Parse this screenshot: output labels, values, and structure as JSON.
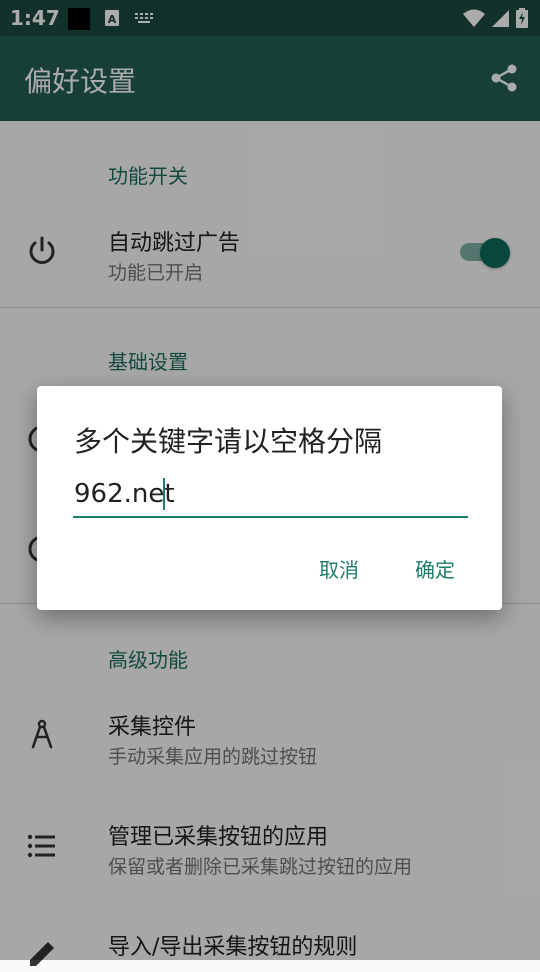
{
  "status_bar": {
    "time": "1:47",
    "icons": [
      "notification-black-square-icon",
      "a-notification-icon",
      "keyboard-icon",
      "wifi-icon",
      "signal-icon",
      "battery-charging-icon"
    ]
  },
  "app_bar": {
    "title": "偏好设置",
    "share_icon": "share-icon"
  },
  "sections": {
    "feature": {
      "header": "功能开关",
      "auto_skip": {
        "title": "自动跳过广告",
        "subtitle": "功能已开启",
        "icon": "power-icon",
        "toggle_on": true
      }
    },
    "basic": {
      "header": "基础设置"
    },
    "advanced": {
      "header": "高级功能",
      "items": [
        {
          "title": "采集控件",
          "subtitle": "手动采集应用的跳过按钮",
          "icon": "compass-icon"
        },
        {
          "title": "管理已采集按钮的应用",
          "subtitle": "保留或者删除已采集跳过按钮的应用",
          "icon": "list-icon"
        },
        {
          "title": "导入/导出采集按钮的规则",
          "icon": "edit-icon"
        }
      ]
    }
  },
  "dialog": {
    "title": "多个关键字请以空格分隔",
    "input_value": "962.net",
    "cancel_label": "取消",
    "ok_label": "确定"
  },
  "colors": {
    "primary": "#235e52",
    "status_bar": "#1c4a40",
    "accent": "#1f7c6b"
  }
}
